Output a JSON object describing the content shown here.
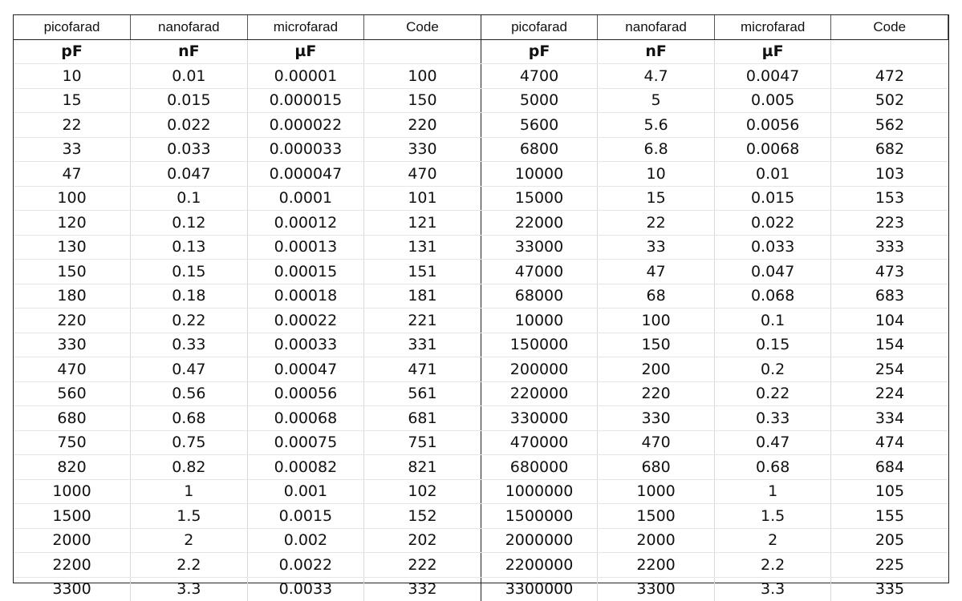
{
  "headers": [
    "picofarad",
    "nanofarad",
    "microfarad",
    "Code",
    "picofarad",
    "nanofarad",
    "microfarad",
    "Code"
  ],
  "units": [
    "pF",
    "nF",
    "µF",
    "",
    "pF",
    "nF",
    "µF",
    ""
  ],
  "rows": [
    [
      "10",
      "0.01",
      "0.00001",
      "100",
      "4700",
      "4.7",
      "0.0047",
      "472"
    ],
    [
      "15",
      "0.015",
      "0.000015",
      "150",
      "5000",
      "5",
      "0.005",
      "502"
    ],
    [
      "22",
      "0.022",
      "0.000022",
      "220",
      "5600",
      "5.6",
      "0.0056",
      "562"
    ],
    [
      "33",
      "0.033",
      "0.000033",
      "330",
      "6800",
      "6.8",
      "0.0068",
      "682"
    ],
    [
      "47",
      "0.047",
      "0.000047",
      "470",
      "10000",
      "10",
      "0.01",
      "103"
    ],
    [
      "100",
      "0.1",
      "0.0001",
      "101",
      "15000",
      "15",
      "0.015",
      "153"
    ],
    [
      "120",
      "0.12",
      "0.00012",
      "121",
      "22000",
      "22",
      "0.022",
      "223"
    ],
    [
      "130",
      "0.13",
      "0.00013",
      "131",
      "33000",
      "33",
      "0.033",
      "333"
    ],
    [
      "150",
      "0.15",
      "0.00015",
      "151",
      "47000",
      "47",
      "0.047",
      "473"
    ],
    [
      "180",
      "0.18",
      "0.00018",
      "181",
      "68000",
      "68",
      "0.068",
      "683"
    ],
    [
      "220",
      "0.22",
      "0.00022",
      "221",
      "10000",
      "100",
      "0.1",
      "104"
    ],
    [
      "330",
      "0.33",
      "0.00033",
      "331",
      "150000",
      "150",
      "0.15",
      "154"
    ],
    [
      "470",
      "0.47",
      "0.00047",
      "471",
      "200000",
      "200",
      "0.2",
      "254"
    ],
    [
      "560",
      "0.56",
      "0.00056",
      "561",
      "220000",
      "220",
      "0.22",
      "224"
    ],
    [
      "680",
      "0.68",
      "0.00068",
      "681",
      "330000",
      "330",
      "0.33",
      "334"
    ],
    [
      "750",
      "0.75",
      "0.00075",
      "751",
      "470000",
      "470",
      "0.47",
      "474"
    ],
    [
      "820",
      "0.82",
      "0.00082",
      "821",
      "680000",
      "680",
      "0.68",
      "684"
    ],
    [
      "1000",
      "1",
      "0.001",
      "102",
      "1000000",
      "1000",
      "1",
      "105"
    ],
    [
      "1500",
      "1.5",
      "0.0015",
      "152",
      "1500000",
      "1500",
      "1.5",
      "155"
    ],
    [
      "2000",
      "2",
      "0.002",
      "202",
      "2000000",
      "2000",
      "2",
      "205"
    ],
    [
      "2200",
      "2.2",
      "0.0022",
      "222",
      "2200000",
      "2200",
      "2.2",
      "225"
    ],
    [
      "3300",
      "3.3",
      "0.0033",
      "332",
      "3300000",
      "3300",
      "3.3",
      "335"
    ]
  ]
}
